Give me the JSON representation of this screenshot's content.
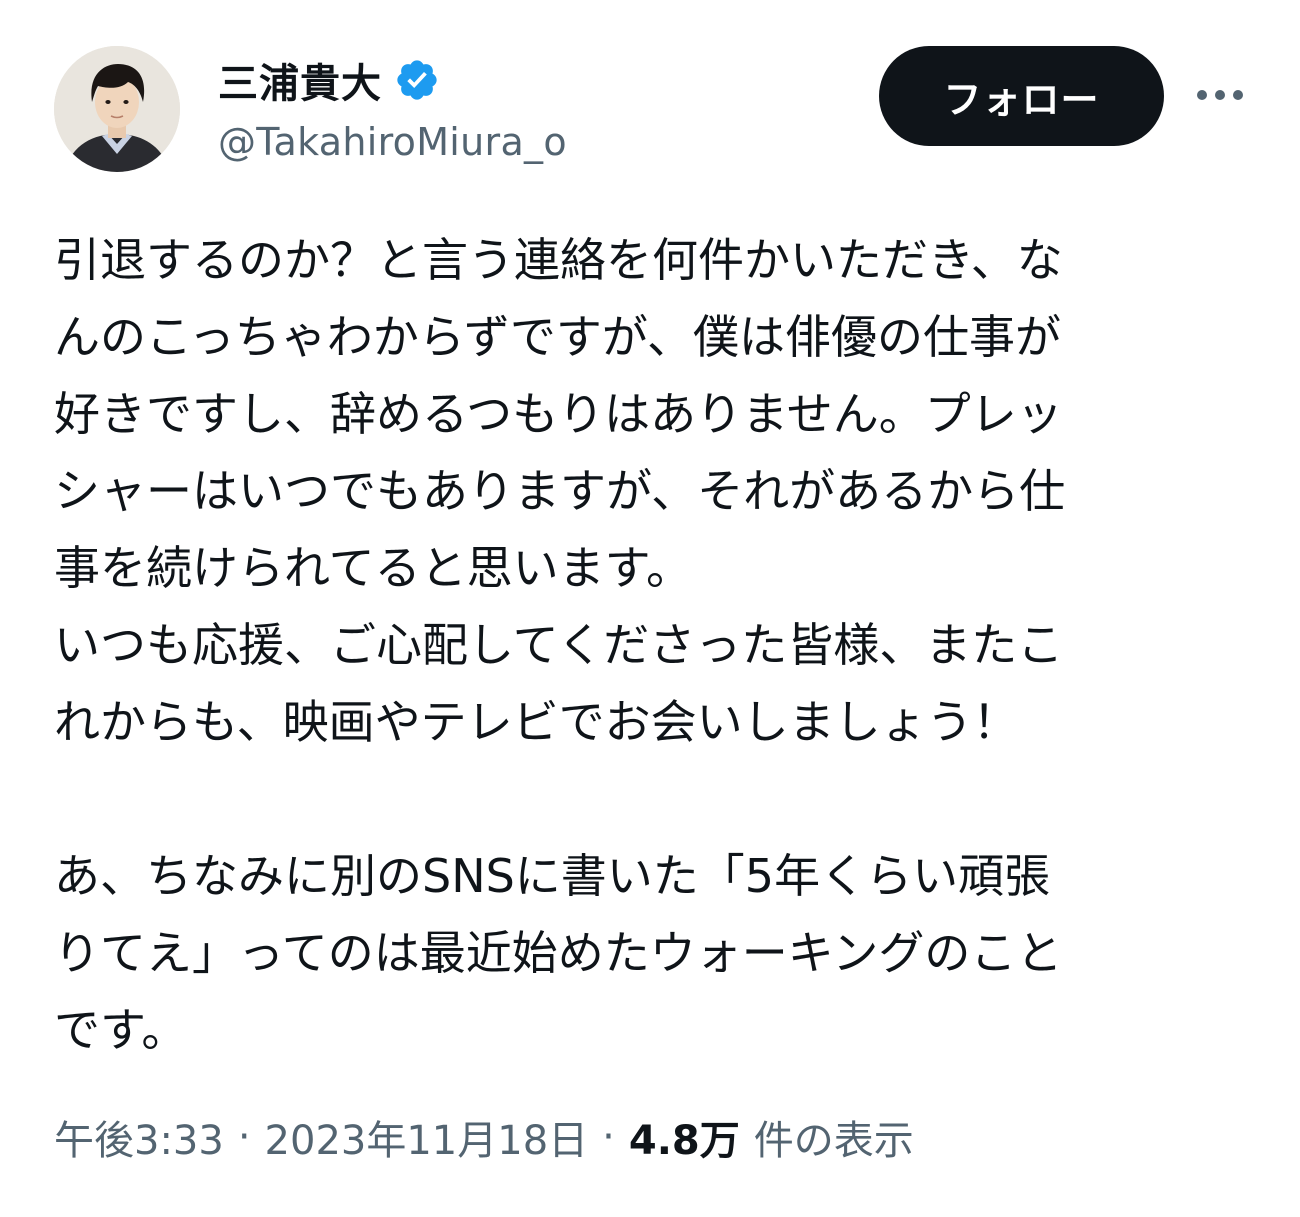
{
  "author": {
    "display_name": "三浦貴大",
    "handle": "@TakahiroMiura_o",
    "verified": true,
    "verified_badge_color": "#1d9bf0",
    "avatar_icon": "profile-photo"
  },
  "actions": {
    "follow_label": "フォロー",
    "more_icon": "more-horizontal-icon"
  },
  "tweet": {
    "lines": [
      "引退するのか？と言う連絡を何件かいただき、な",
      "んのこっちゃわからずですが、僕は俳優の仕事が",
      "好きですし、辞めるつもりはありません。プレッ",
      "シャーはいつでもありますが、それがあるから仕",
      "事を続けられてると思います。",
      "いつも応援、ご心配してくださった皆様、またこ",
      "れからも、映画やテレビでお会いしましょう！",
      "",
      "あ、ちなみに別のSNSに書いた「5年くらい頑張",
      "りてえ」ってのは最近始めたウォーキングのこと",
      "です。"
    ]
  },
  "meta": {
    "time": "午後3:33",
    "separator": "·",
    "date": "2023年11月18日",
    "views_count": "4.8万",
    "views_label": "件の表示"
  }
}
